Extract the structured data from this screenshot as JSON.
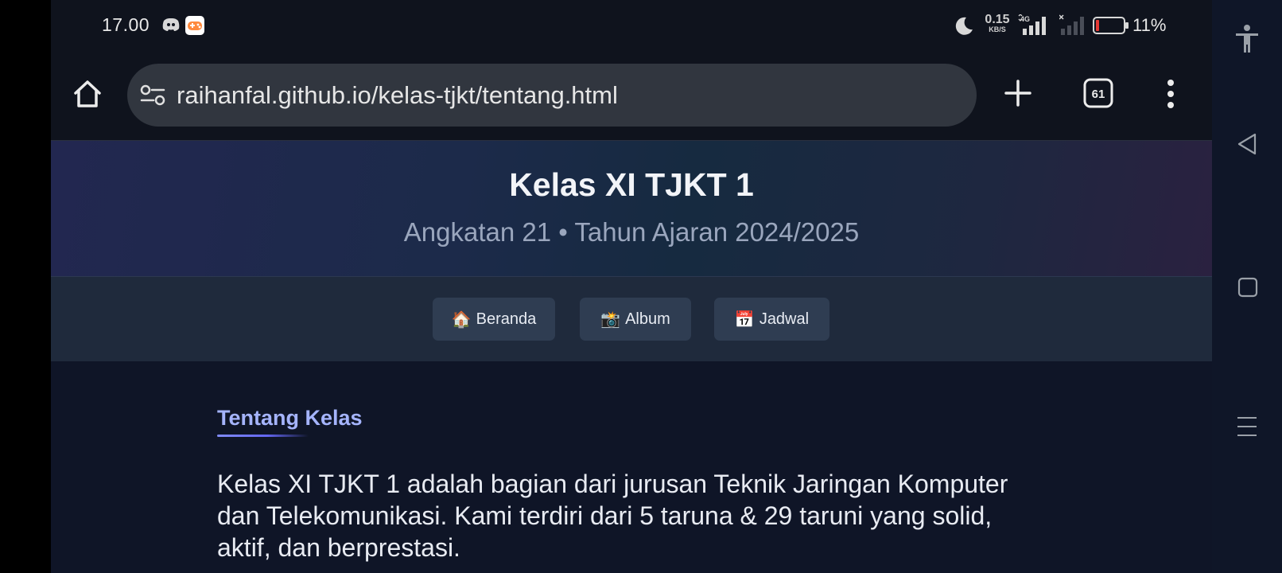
{
  "status_bar": {
    "time": "17.00",
    "net_speed_value": "0.15",
    "net_speed_unit": "KB/S",
    "network_type": "4G",
    "battery_percent": "11%",
    "battery_color": "#e53935",
    "icons": [
      "discord-icon",
      "game-app-icon",
      "moon-icon",
      "signal-4g-icon",
      "signal-no-service-icon",
      "battery-icon"
    ]
  },
  "browser": {
    "url": "raihanfal.github.io/kelas-tjkt/tentang.html",
    "tab_count": "61",
    "icons": [
      "home-icon",
      "site-settings-icon",
      "new-tab-icon",
      "tab-switcher-icon",
      "more-menu-icon"
    ]
  },
  "page": {
    "title": "Kelas XI TJKT 1",
    "subtitle": "Angkatan 21 • Tahun Ajaran 2024/2025",
    "nav": [
      {
        "emoji": "🏠",
        "label": "Beranda"
      },
      {
        "emoji": "📸",
        "label": "Album"
      },
      {
        "emoji": "📅",
        "label": "Jadwal"
      }
    ],
    "section_title": "Tentang Kelas",
    "accent_color": "#a5b4fc",
    "paragraph": "Kelas XI TJKT 1 adalah bagian dari jurusan Teknik Jaringan Komputer dan Telekomunikasi. Kami terdiri dari 5 taruna & 29 taruni yang solid, aktif, dan berprestasi."
  },
  "system_nav": {
    "icons": [
      "accessibility-icon",
      "back-icon",
      "recents-icon",
      "menu-icon"
    ]
  }
}
